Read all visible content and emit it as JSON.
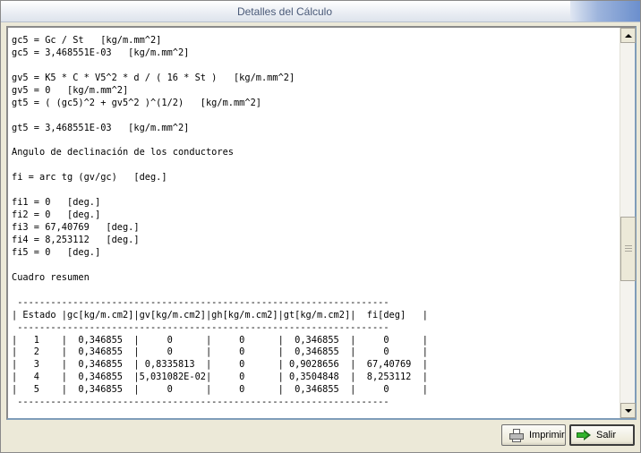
{
  "window": {
    "title": "Detalles del Cálculo"
  },
  "report": {
    "lines": [
      "gc5 = Gc / St   [kg/m.mm^2]",
      "gc5 = 3,468551E-03   [kg/m.mm^2]",
      "",
      "gv5 = K5 * C * V5^2 * d / ( 16 * St )   [kg/m.mm^2]",
      "gv5 = 0   [kg/m.mm^2]",
      "gt5 = ( (gc5)^2 + gv5^2 )^(1/2)   [kg/m.mm^2]",
      "",
      "gt5 = 3,468551E-03   [kg/m.mm^2]",
      "",
      "Angulo de declinación de los conductores",
      "",
      "fi = arc tg (gv/gc)   [deg.]",
      "",
      "fi1 = 0   [deg.]",
      "fi2 = 0   [deg.]",
      "fi3 = 67,40769   [deg.]",
      "fi4 = 8,253112   [deg.]",
      "fi5 = 0   [deg.]",
      "",
      "Cuadro resumen",
      "",
      " -------------------------------------------------------------------",
      "| Estado |gc[kg/m.cm2]|gv[kg/m.cm2]|gh[kg/m.cm2]|gt[kg/m.cm2]|  fi[deg]   |",
      " -------------------------------------------------------------------",
      "|   1    |  0,346855  |     0      |     0      |  0,346855  |     0      |",
      "|   2    |  0,346855  |     0      |     0      |  0,346855  |     0      |",
      "|   3    |  0,346855  | 0,8335813  |     0      | 0,9028656  |  67,40769  |",
      "|   4    |  0,346855  |5,031082E-02|     0      | 0,3504848  |  8,253112  |",
      "|   5    |  0,346855  |     0      |     0      |  0,346855  |     0      |",
      " -------------------------------------------------------------------"
    ]
  },
  "buttons": {
    "print_label": "Imprimir",
    "exit_label": "Salir"
  },
  "icons": {
    "print": "printer-icon",
    "exit": "green-arrow-right-icon"
  },
  "colors": {
    "title_text": "#4a5a78",
    "text_frame_border": "#7f9db9",
    "window_bg": "#ece9d8"
  }
}
